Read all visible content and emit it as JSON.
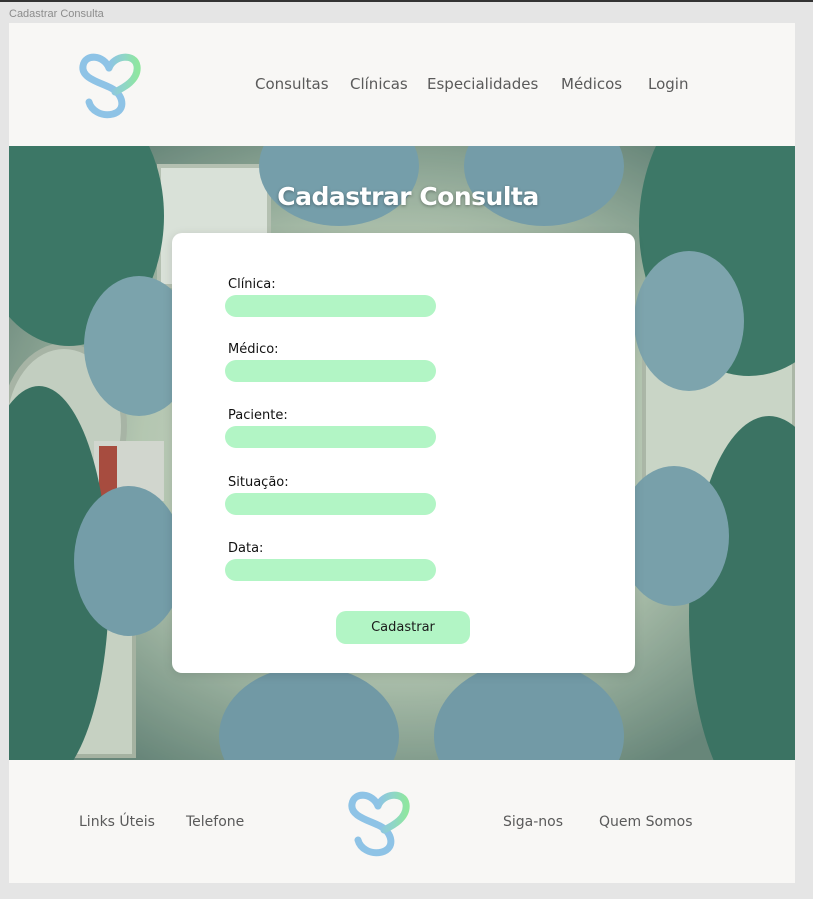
{
  "frame": {
    "label": "Cadastrar Consulta"
  },
  "header": {
    "logo_icon": "heart-s-logo-icon",
    "nav": [
      {
        "label": "Consultas"
      },
      {
        "label": "Clínicas"
      },
      {
        "label": "Especialidades"
      },
      {
        "label": "Médicos"
      },
      {
        "label": "Login"
      }
    ]
  },
  "hero": {
    "title": "Cadastrar Consulta",
    "background": "surgeons-looking-down-photo"
  },
  "form": {
    "fields": [
      {
        "label": "Clínica:",
        "value": "",
        "placeholder": ""
      },
      {
        "label": "Médico:",
        "value": "",
        "placeholder": ""
      },
      {
        "label": "Paciente:",
        "value": "",
        "placeholder": ""
      },
      {
        "label": "Situação:",
        "value": "",
        "placeholder": ""
      },
      {
        "label": "Data:",
        "value": "",
        "placeholder": ""
      }
    ],
    "submit_label": "Cadastrar"
  },
  "footer": {
    "links_left": [
      {
        "label": "Links Úteis"
      },
      {
        "label": "Telefone"
      }
    ],
    "links_right": [
      {
        "label": "Siga-nos"
      },
      {
        "label": "Quem Somos"
      }
    ],
    "logo_icon": "heart-s-logo-icon"
  },
  "colors": {
    "accent_green": "#b2f5c5",
    "logo_blue": "#8ec3e6",
    "logo_green": "#8fe6a0",
    "page_bg": "#f8f7f5",
    "nav_text": "#5a5a5a"
  }
}
